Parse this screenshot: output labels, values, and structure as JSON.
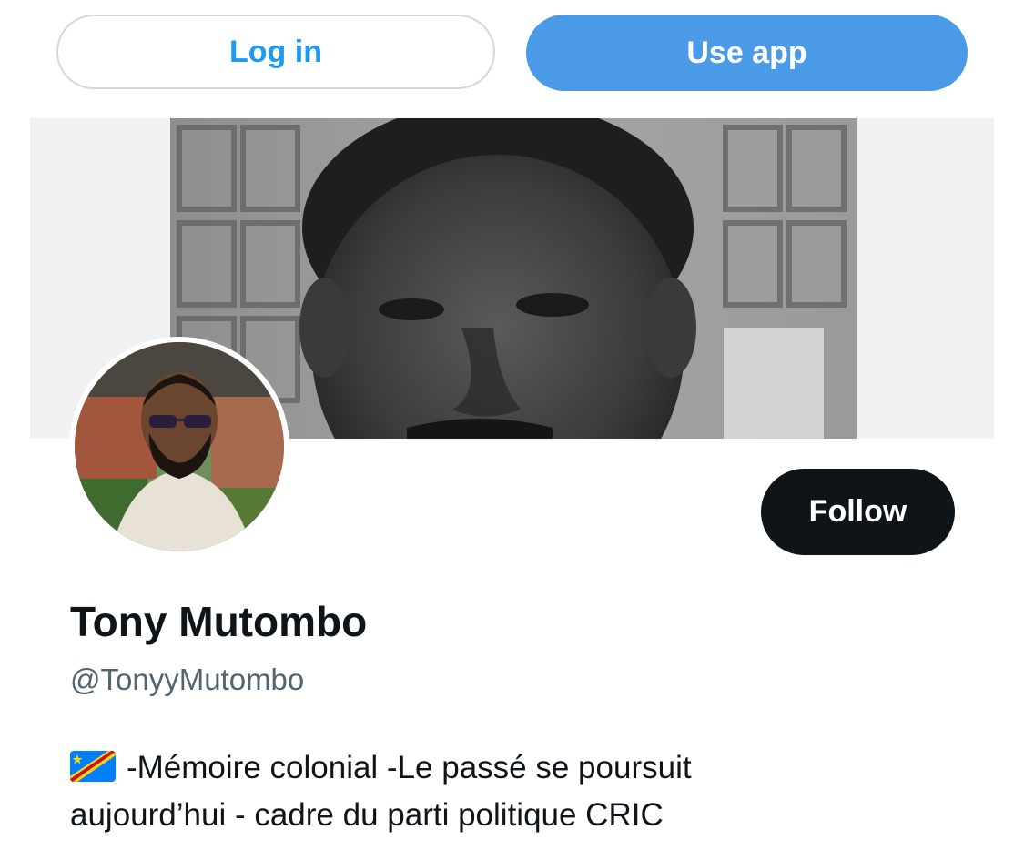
{
  "topbar": {
    "login_label": "Log in",
    "use_app_label": "Use app"
  },
  "colors": {
    "brand_blue": "#1d9bf0",
    "use_app_bg": "#4a9ae8",
    "follow_bg": "#0f1419",
    "text_primary": "#0f1419",
    "text_secondary": "#536471"
  },
  "banner": {
    "description_icon": "banner-photo-black-and-white-portrait"
  },
  "profile": {
    "avatar_icon": "avatar-photo",
    "follow_label": "Follow",
    "display_name": "Tony Mutombo",
    "handle": "@TonyyMutombo",
    "bio_flag_icon": "dr-congo-flag-icon",
    "bio_line1": "-Mémoire colonial -Le passé se poursuit",
    "bio_line2": "aujourd’hui - cadre du parti politique CRIC"
  }
}
